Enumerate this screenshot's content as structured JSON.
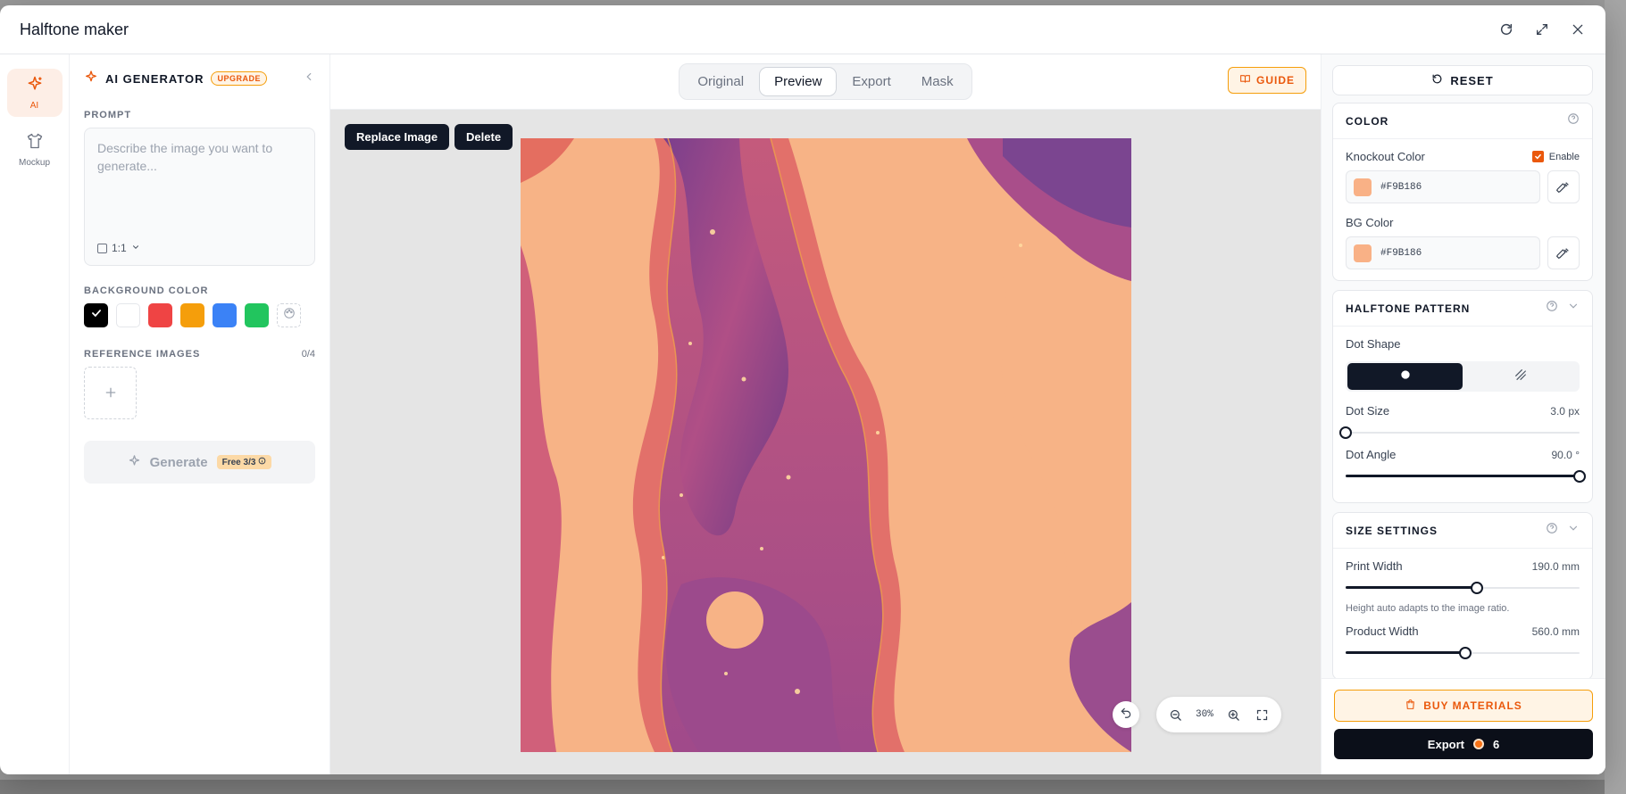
{
  "window": {
    "title": "Halftone maker"
  },
  "rail": {
    "items": [
      {
        "label": "AI",
        "icon": "sparkles-icon"
      },
      {
        "label": "Mockup",
        "icon": "tshirt-icon"
      }
    ]
  },
  "left": {
    "title": "AI GENERATOR",
    "badge": "UPGRADE",
    "prompt_label": "PROMPT",
    "prompt_placeholder": "Describe the image you want to generate...",
    "prompt_value": "",
    "ratio": "1:1",
    "bg_color_label": "BACKGROUND COLOR",
    "bg_colors": [
      "#000000",
      "#ffffff",
      "#ef4444",
      "#f59e0b",
      "#3b82f6",
      "#22c55e"
    ],
    "ref_label": "REFERENCE IMAGES",
    "ref_count": "0/4",
    "generate_label": "Generate",
    "free_badge": "Free 3/3"
  },
  "center": {
    "tabs": [
      "Original",
      "Preview",
      "Export",
      "Mask"
    ],
    "active_tab": "Preview",
    "guide_label": "GUIDE",
    "replace_label": "Replace Image",
    "delete_label": "Delete",
    "zoom": "30%"
  },
  "right": {
    "reset_label": "RESET",
    "color": {
      "title": "COLOR",
      "knockout_label": "Knockout Color",
      "enable_label": "Enable",
      "enabled": true,
      "knockout_hex": "#F9B186",
      "bg_label": "BG Color",
      "bg_hex": "#F9B186"
    },
    "halftone": {
      "title": "HALFTONE PATTERN",
      "dot_shape_label": "Dot Shape",
      "dot_size_label": "Dot Size",
      "dot_size_value": "3.0",
      "dot_size_unit": "px",
      "dot_size_fraction": 0.0,
      "dot_angle_label": "Dot Angle",
      "dot_angle_value": "90.0",
      "dot_angle_unit": "°",
      "dot_angle_fraction": 1.0
    },
    "size": {
      "title": "SIZE SETTINGS",
      "print_width_label": "Print Width",
      "print_width_value": "190.0",
      "print_width_unit": "mm",
      "print_width_fraction": 0.56,
      "hint": "Height auto adapts to the image ratio.",
      "product_width_label": "Product Width",
      "product_width_value": "560.0",
      "product_width_unit": "mm",
      "product_width_fraction": 0.51
    },
    "buy_label": "BUY MATERIALS",
    "export_label": "Export",
    "export_credits": "6"
  },
  "colors": {
    "accent": "#ea580c",
    "dark": "#111827",
    "knockout": "#F9B186"
  }
}
